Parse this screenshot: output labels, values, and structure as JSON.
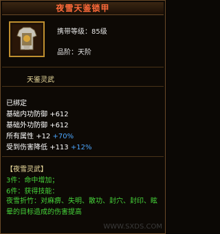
{
  "item": {
    "name": "夜雪天鉴锁甲",
    "level_text": "携带等级：85级",
    "grade_text": "品阶：天阶",
    "sub_name": "天鉴灵武",
    "bound": "已绑定",
    "stats": [
      {
        "label": "基础内功防御",
        "value": "+612"
      },
      {
        "label": "基础外功防御",
        "value": "+612"
      },
      {
        "label": "所有属性",
        "value": "+12",
        "bonus": "+70%"
      },
      {
        "label": "受到伤害降低",
        "value": "+113",
        "bonus": "+12%"
      }
    ],
    "set": {
      "title": "【夜雪灵武】",
      "bonus_3": "3件：命中增加；",
      "bonus_6": "6件：获得技能：",
      "skill_text": "夜雪折竹：对麻痹、失明、散功、封穴、封印、眩晕的目标造成的伤害提高"
    }
  },
  "watermark": "WWW.SXDS.COM"
}
